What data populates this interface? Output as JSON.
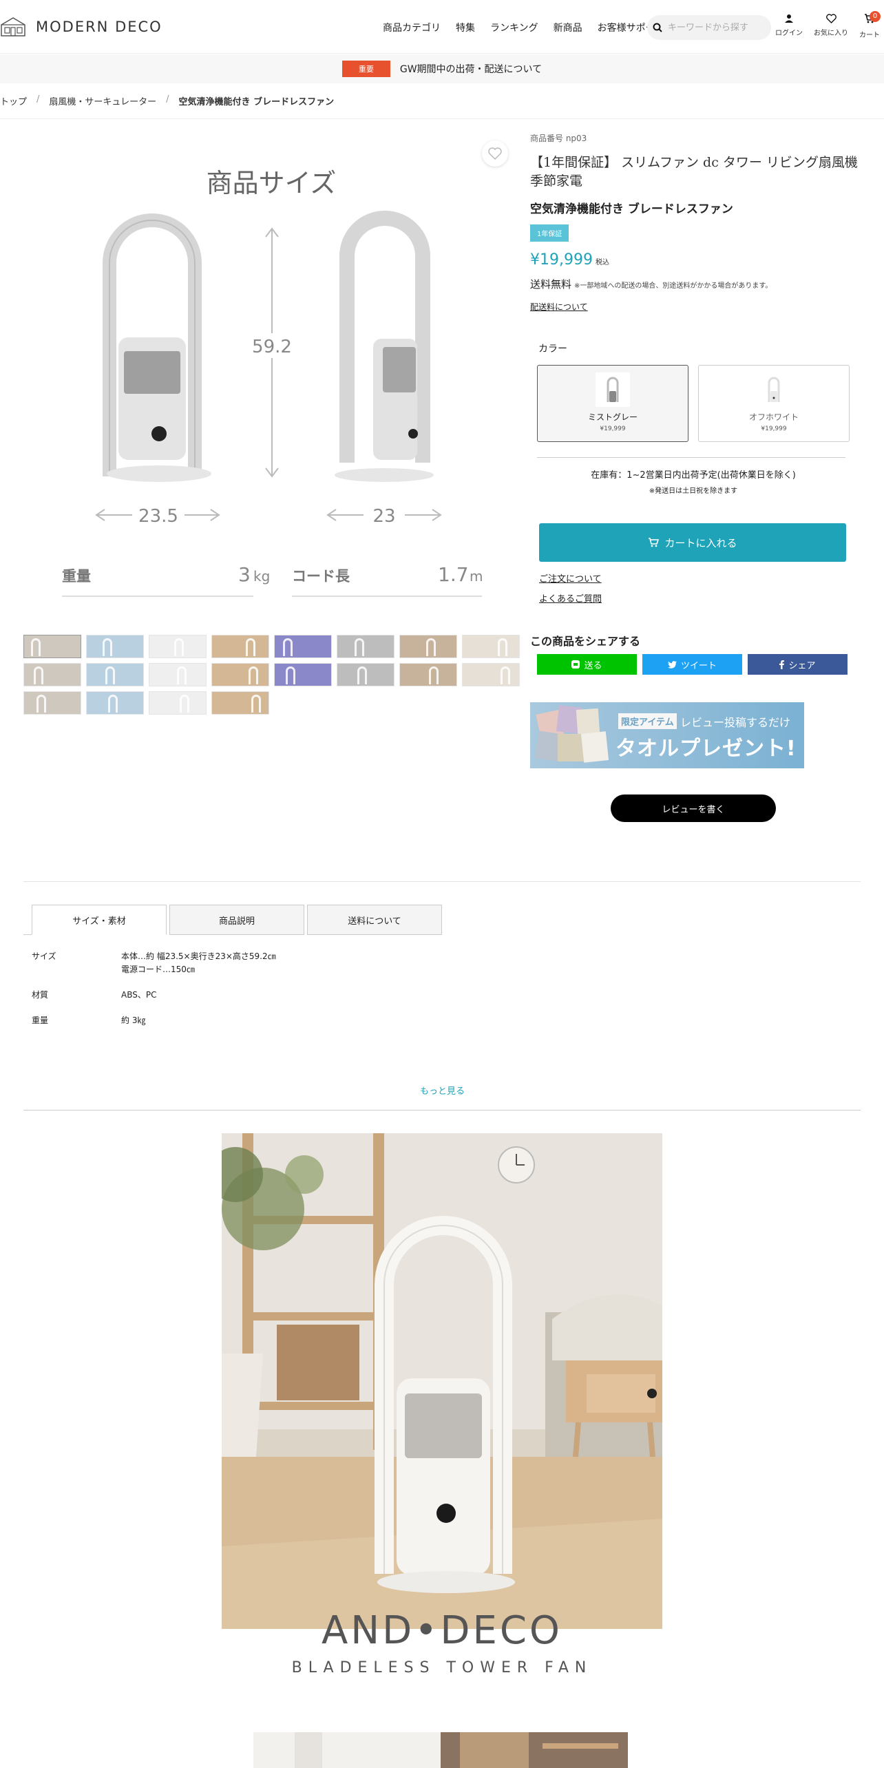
{
  "header": {
    "logo_text": "MODERN DECO",
    "nav": [
      "商品カテゴリ",
      "特集",
      "ランキング",
      "新商品",
      "お客様サポート"
    ],
    "search_placeholder": "キーワードから探す",
    "login_label": "ログイン",
    "favorites_label": "お気に入り",
    "cart_label": "カート",
    "cart_count": "0"
  },
  "notice": {
    "badge": "重要",
    "text": "GW期間中の出荷・配送について"
  },
  "breadcrumb": [
    "トップ",
    "扇風機・サーキュレーター",
    "空気清浄機能付き ブレードレスファン"
  ],
  "product_image": {
    "heading": "商品サイズ",
    "height": "59.2",
    "width": "23.5",
    "depth": "23",
    "weight_label": "重量",
    "weight_value": "3",
    "weight_unit": "kg",
    "cord_label": "コード長",
    "cord_value": "1.7",
    "cord_unit": "m",
    "thumbnail_count": 20
  },
  "product": {
    "sku": "商品番号 np03",
    "title": "【1年間保証】 スリムファン dc タワー リビング扇風機 季節家電",
    "subtitle": "空気清浄機能付き ブレードレスファン",
    "warranty_badge": "1年保証",
    "price": "¥19,999",
    "tax_label": "税込",
    "shipping": "送料無料",
    "shipping_note": "※一部地域への配送の場合、別途送料がかかる場合があります。",
    "shipping_link": "配送料について"
  },
  "color": {
    "label": "カラー",
    "options": [
      {
        "name": "ミストグレー",
        "price": "¥19,999"
      },
      {
        "name": "オフホワイト",
        "price": "¥19,999"
      }
    ],
    "stock": "在庫有：1~2営業日内出荷予定(出荷休業日を除く)",
    "stock_note": "※発送日は土日祝を除きます"
  },
  "actions": {
    "cart_button": "カートに入れる",
    "order_link": "ご注文について",
    "faq_link": "よくあるご質問"
  },
  "share": {
    "title": "この商品をシェアする",
    "line": "送る",
    "twitter": "ツイート",
    "facebook": "シェア",
    "colors": {
      "line": "#00c300",
      "twitter": "#1da1f2",
      "facebook": "#3b5998"
    }
  },
  "banner": {
    "tag": "限定アイテム",
    "line1": "レビュー投稿するだけ",
    "line2": "タオルプレゼント!"
  },
  "review_button": "レビューを書く",
  "tabs": [
    "サイズ・素材",
    "商品説明",
    "送料について"
  ],
  "specs": [
    {
      "key": "サイズ",
      "value1": "本体…約 幅23.5×奥行き23×高さ59.2㎝",
      "value2": "電源コード…150㎝"
    },
    {
      "key": "材質",
      "value1": "ABS、PC",
      "value2": ""
    },
    {
      "key": "重量",
      "value1": "約 3㎏",
      "value2": ""
    }
  ],
  "more_link": "もっと見る",
  "brand": {
    "title": "AND•DECO",
    "subtitle": "BLADELESS TOWER FAN"
  },
  "accent_color": "#1fa3b8"
}
